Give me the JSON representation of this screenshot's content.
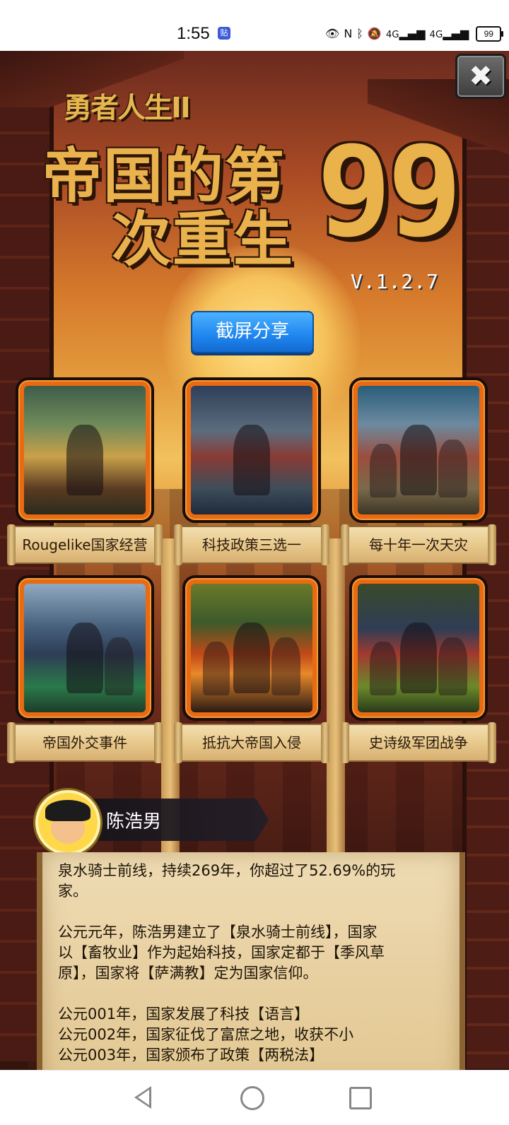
{
  "status_bar": {
    "time": "1:55",
    "app_icon_label": "贴",
    "battery": "99",
    "network_a": "4G",
    "network_b": "4G"
  },
  "game": {
    "title_sub": "勇者人生II",
    "title_line1": "帝国的第",
    "title_line2": "次重生",
    "title_number": "99",
    "version": "V.1.2.7",
    "share_button": "截屏分享"
  },
  "features": [
    {
      "label": "Rougelike国家经营",
      "art": "town"
    },
    {
      "label": "科技政策三选一",
      "art": "king"
    },
    {
      "label": "每十年一次天灾",
      "art": "battle"
    },
    {
      "label": "帝国外交事件",
      "art": "diplomacy"
    },
    {
      "label": "抵抗大帝国入侵",
      "art": "invasion"
    },
    {
      "label": "史诗级军团战争",
      "art": "war"
    }
  ],
  "player": {
    "name": "陈浩男"
  },
  "history": {
    "lines": [
      "泉水骑士前线，持续269年，你超过了52.69%的玩",
      "家。",
      "",
      "公元元年，陈浩男建立了【泉水骑士前线】，国家",
      "以【畜牧业】作为起始科技，国家定都于【季风草",
      "原】，国家将【萨满教】定为国家信仰。",
      "",
      "公元001年，国家发展了科技【语言】",
      "公元002年，国家征伐了富庶之地，收获不小",
      "公元003年，国家颁布了政策【两税法】"
    ]
  },
  "colors": {
    "title_gold": "#e9b24c",
    "share_blue": "#1f86ef",
    "card_orange": "#e86a12",
    "scroll_paper": "#e8c98c"
  }
}
